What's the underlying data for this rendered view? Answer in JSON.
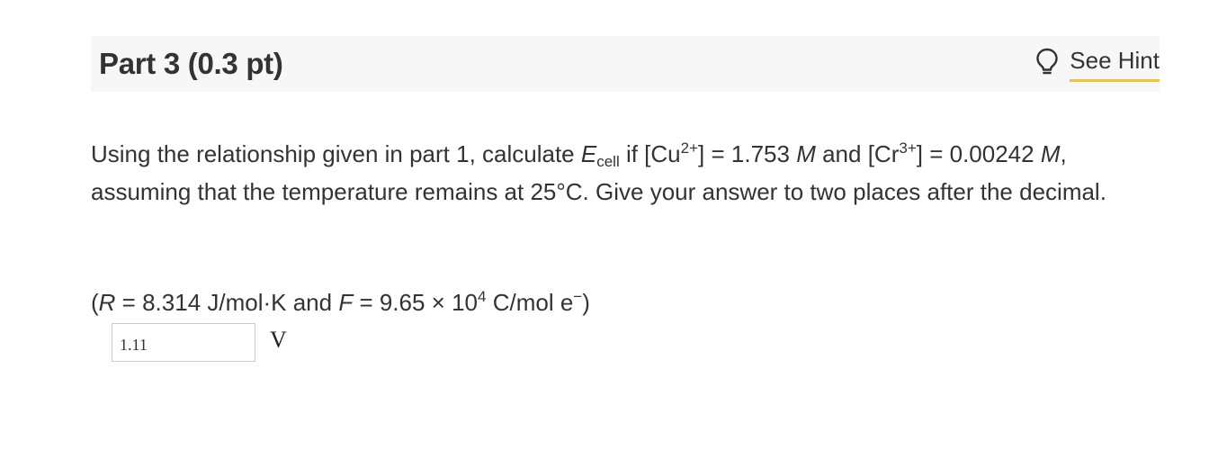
{
  "part": {
    "title": "Part 3 (0.3 pt)",
    "hint_label": "See Hint",
    "hint_icon": "lightbulb-icon",
    "hint_underline_color": "#e3c25e"
  },
  "question": {
    "t1": "Using the relationship given in part 1, calculate ",
    "e_symbol": "E",
    "e_sub": "cell",
    "t2": " if [Cu",
    "cu_charge": "2+",
    "t3": "] = 1.753 ",
    "m1": "M",
    "t4": " and [Cr",
    "cr_charge": "3+",
    "t5": "] = 0.00242 ",
    "m2": "M",
    "t6": ", assuming that the temperature remains at 25°C. Give your answer to two places after the decimal."
  },
  "constants": {
    "open": "(",
    "r_symbol": "R",
    "r_value": " = 8.314 J/mol·K and ",
    "f_symbol": "F",
    "f_value": " = 9.65 × 10",
    "f_exp": "4",
    "f_unit": " C/mol e",
    "e_charge": "−",
    "close": ")"
  },
  "answer": {
    "value": "1.11",
    "unit": "V"
  }
}
